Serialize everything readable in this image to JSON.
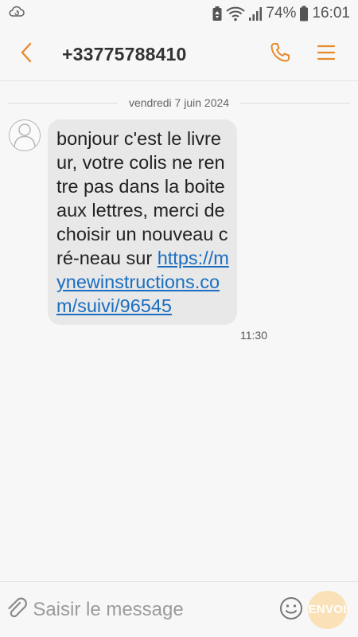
{
  "status_bar": {
    "battery_percent": "74%",
    "time": "16:01",
    "icons": [
      "cloud-sync-icon",
      "battery-saver-icon",
      "wifi-icon",
      "signal-icon",
      "battery-icon"
    ]
  },
  "header": {
    "contact": "+33775788410",
    "icons": [
      "back-chevron-icon",
      "phone-icon",
      "menu-icon"
    ],
    "accent_color": "#e8892b"
  },
  "conversation": {
    "date": "vendredi 7 juin 2024",
    "messages": [
      {
        "text_before_link": "bonjour c'est le livreur, votre colis ne rentre pas dans la boite aux lettres, merci de choisir un nouveau cré-neau sur ",
        "link": "https://mynewinstructions.com/suivi/96545",
        "time": "11:30",
        "direction": "incoming"
      }
    ]
  },
  "composer": {
    "placeholder": "Saisir le message",
    "value": "",
    "send_label": "ENVOI",
    "icons": [
      "attachment-icon",
      "emoji-icon"
    ]
  }
}
